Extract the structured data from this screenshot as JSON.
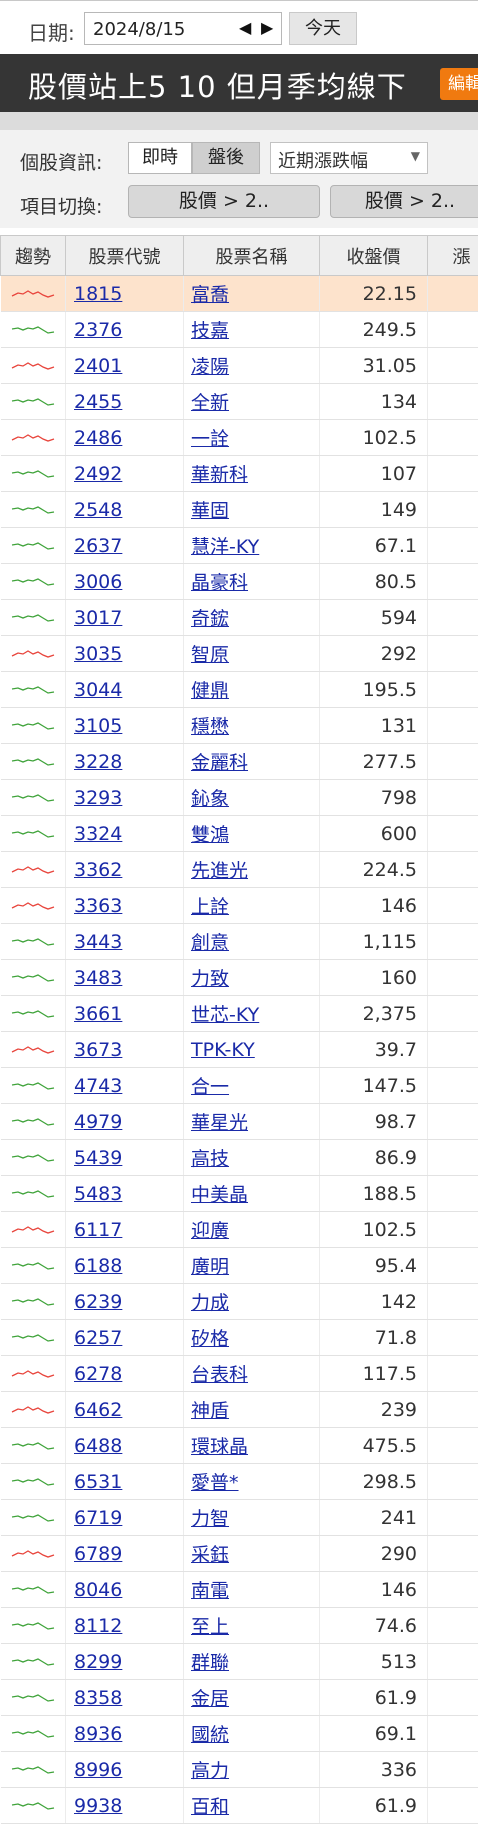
{
  "toolbar": {
    "date_label": "日期:",
    "date_value": "2024/8/15",
    "prev_arrow": "◀",
    "next_arrow": "▶",
    "today_label": "今天"
  },
  "title_bar": {
    "title": "股價站上5 10 但月季均線下",
    "edit_label": "編輯"
  },
  "controls": {
    "info_label": "個股資訊:",
    "realtime_label": "即時",
    "closing_label": "盤後",
    "select_value": "近期漲跌幅",
    "switch_label": "項目切換:",
    "switch_btn_1": "股價 > 2..",
    "switch_btn_2": "股價 > 2.."
  },
  "table": {
    "headers": [
      "趨勢",
      "股票代號",
      "股票名稱",
      "收盤價",
      "漲"
    ],
    "rows": [
      {
        "trend": "red",
        "code": "1815",
        "name": "富喬",
        "close": "22.15"
      },
      {
        "trend": "green",
        "code": "2376",
        "name": "技嘉",
        "close": "249.5"
      },
      {
        "trend": "red",
        "code": "2401",
        "name": "凌陽",
        "close": "31.05"
      },
      {
        "trend": "green",
        "code": "2455",
        "name": "全新",
        "close": "134"
      },
      {
        "trend": "red",
        "code": "2486",
        "name": "一詮",
        "close": "102.5"
      },
      {
        "trend": "green",
        "code": "2492",
        "name": "華新科",
        "close": "107"
      },
      {
        "trend": "green",
        "code": "2548",
        "name": "華固",
        "close": "149"
      },
      {
        "trend": "green",
        "code": "2637",
        "name": "慧洋-KY",
        "close": "67.1"
      },
      {
        "trend": "green",
        "code": "3006",
        "name": "晶豪科",
        "close": "80.5"
      },
      {
        "trend": "green",
        "code": "3017",
        "name": "奇鋐",
        "close": "594"
      },
      {
        "trend": "red",
        "code": "3035",
        "name": "智原",
        "close": "292"
      },
      {
        "trend": "green",
        "code": "3044",
        "name": "健鼎",
        "close": "195.5"
      },
      {
        "trend": "green",
        "code": "3105",
        "name": "穩懋",
        "close": "131"
      },
      {
        "trend": "green",
        "code": "3228",
        "name": "金麗科",
        "close": "277.5"
      },
      {
        "trend": "green",
        "code": "3293",
        "name": "鈊象",
        "close": "798"
      },
      {
        "trend": "green",
        "code": "3324",
        "name": "雙鴻",
        "close": "600"
      },
      {
        "trend": "red",
        "code": "3362",
        "name": "先進光",
        "close": "224.5"
      },
      {
        "trend": "red",
        "code": "3363",
        "name": "上詮",
        "close": "146"
      },
      {
        "trend": "green",
        "code": "3443",
        "name": "創意",
        "close": "1,115"
      },
      {
        "trend": "green",
        "code": "3483",
        "name": "力致",
        "close": "160"
      },
      {
        "trend": "green",
        "code": "3661",
        "name": "世芯-KY",
        "close": "2,375"
      },
      {
        "trend": "red",
        "code": "3673",
        "name": "TPK-KY",
        "close": "39.7"
      },
      {
        "trend": "green",
        "code": "4743",
        "name": "合一",
        "close": "147.5"
      },
      {
        "trend": "green",
        "code": "4979",
        "name": "華星光",
        "close": "98.7"
      },
      {
        "trend": "green",
        "code": "5439",
        "name": "高技",
        "close": "86.9"
      },
      {
        "trend": "green",
        "code": "5483",
        "name": "中美晶",
        "close": "188.5"
      },
      {
        "trend": "red",
        "code": "6117",
        "name": "迎廣",
        "close": "102.5"
      },
      {
        "trend": "green",
        "code": "6188",
        "name": "廣明",
        "close": "95.4"
      },
      {
        "trend": "green",
        "code": "6239",
        "name": "力成",
        "close": "142"
      },
      {
        "trend": "green",
        "code": "6257",
        "name": "矽格",
        "close": "71.8"
      },
      {
        "trend": "red",
        "code": "6278",
        "name": "台表科",
        "close": "117.5"
      },
      {
        "trend": "red",
        "code": "6462",
        "name": "神盾",
        "close": "239"
      },
      {
        "trend": "green",
        "code": "6488",
        "name": "環球晶",
        "close": "475.5"
      },
      {
        "trend": "green",
        "code": "6531",
        "name": "愛普*",
        "close": "298.5"
      },
      {
        "trend": "green",
        "code": "6719",
        "name": "力智",
        "close": "241"
      },
      {
        "trend": "red",
        "code": "6789",
        "name": "采鈺",
        "close": "290"
      },
      {
        "trend": "green",
        "code": "8046",
        "name": "南電",
        "close": "146"
      },
      {
        "trend": "green",
        "code": "8112",
        "name": "至上",
        "close": "74.6"
      },
      {
        "trend": "green",
        "code": "8299",
        "name": "群聯",
        "close": "513"
      },
      {
        "trend": "green",
        "code": "8358",
        "name": "金居",
        "close": "61.9"
      },
      {
        "trend": "green",
        "code": "8936",
        "name": "國統",
        "close": "69.1"
      },
      {
        "trend": "green",
        "code": "8996",
        "name": "高力",
        "close": "336"
      },
      {
        "trend": "green",
        "code": "9938",
        "name": "百和",
        "close": "61.9"
      }
    ]
  },
  "colors": {
    "trend_red": "#e8453c",
    "trend_green": "#3fa33a",
    "selected_row": "#fde3cc",
    "link": "#1a2aa8",
    "edit_button": "#f07a10"
  }
}
